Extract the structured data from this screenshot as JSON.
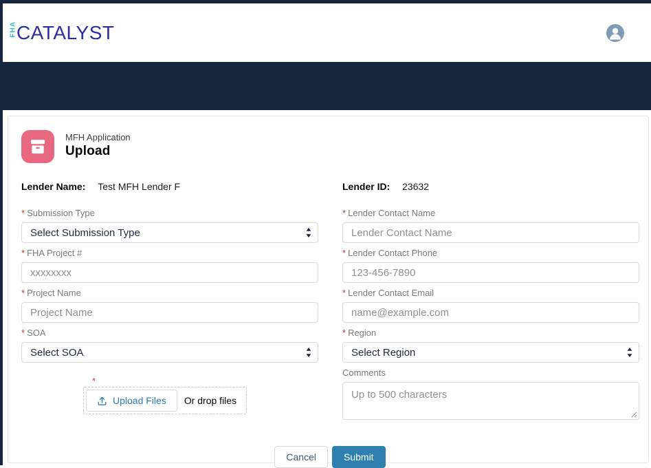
{
  "colors": {
    "navy": "#16263f",
    "logo_teal": "#35bdc6",
    "logo_blue": "#2b2fa0",
    "tile_pink": "#e8697f",
    "accent_blue": "#2e7fae",
    "required_red": "#c23934"
  },
  "marks": {
    "required": "*"
  },
  "header": {
    "logo_fha": "FHA",
    "logo_catalyst": "CATALYST",
    "avatar_icon": "user-icon"
  },
  "page": {
    "icon": "box-icon",
    "subtitle": "MFH Application",
    "title": "Upload"
  },
  "lender": {
    "name_label": "Lender Name:",
    "name_value": "Test MFH Lender F",
    "id_label": "Lender ID:",
    "id_value": "23632"
  },
  "form": {
    "left": [
      {
        "label": "Submission Type",
        "required": true,
        "type": "select",
        "value": "Select Submission Type"
      },
      {
        "label": "FHA Project #",
        "required": true,
        "type": "input",
        "placeholder": "xxxxxxxx"
      },
      {
        "label": "Project Name",
        "required": true,
        "type": "input",
        "placeholder": "Project Name"
      },
      {
        "label": "SOA",
        "required": true,
        "type": "select",
        "value": "Select SOA"
      }
    ],
    "right": [
      {
        "label": "Lender Contact Name",
        "required": true,
        "type": "input",
        "placeholder": "Lender Contact Name"
      },
      {
        "label": "Lender Contact Phone",
        "required": true,
        "type": "input",
        "placeholder": "123-456-7890"
      },
      {
        "label": "Lender Contact Email",
        "required": true,
        "type": "input",
        "placeholder": "name@example.com"
      },
      {
        "label": "Region",
        "required": true,
        "type": "select",
        "value": "Select Region"
      },
      {
        "label": "Comments",
        "required": false,
        "type": "textarea",
        "placeholder": "Up to 500 characters"
      }
    ]
  },
  "upload": {
    "button_label": "Upload Files",
    "drop_label": "Or drop files"
  },
  "footer": {
    "cancel_label": "Cancel",
    "submit_label": "Submit"
  }
}
